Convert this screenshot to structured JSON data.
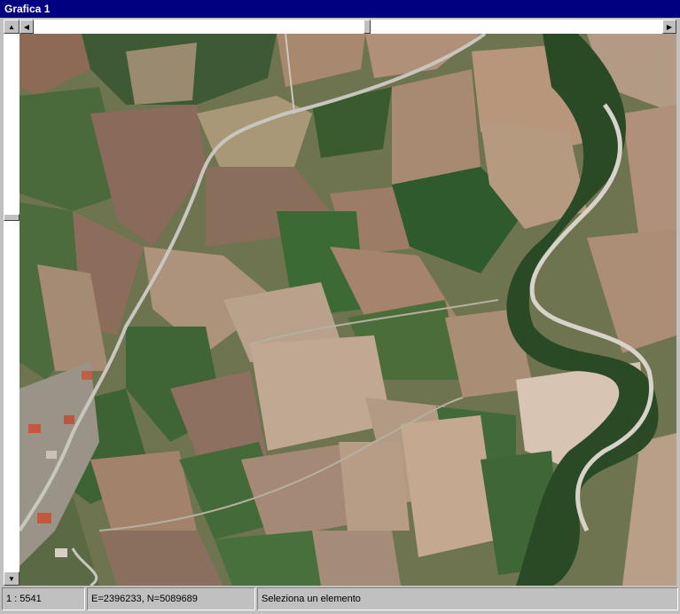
{
  "window": {
    "title": "Grafica 1"
  },
  "map": {
    "content": "aerial orthophoto"
  },
  "status": {
    "scale": "1 : 5541",
    "coordinates": "E=2396233, N=5089689",
    "message": "Seleziona un elemento"
  },
  "scrollbars": {
    "horizontal_position": 0.53,
    "vertical_position": 0.34
  },
  "icons": {
    "scroll_up": "arrow-up-icon",
    "scroll_down": "arrow-down-icon",
    "scroll_left": "arrow-left-icon",
    "scroll_right": "arrow-right-icon"
  },
  "colors": {
    "titlebar": "#000080",
    "chrome": "#c0c0c0"
  }
}
